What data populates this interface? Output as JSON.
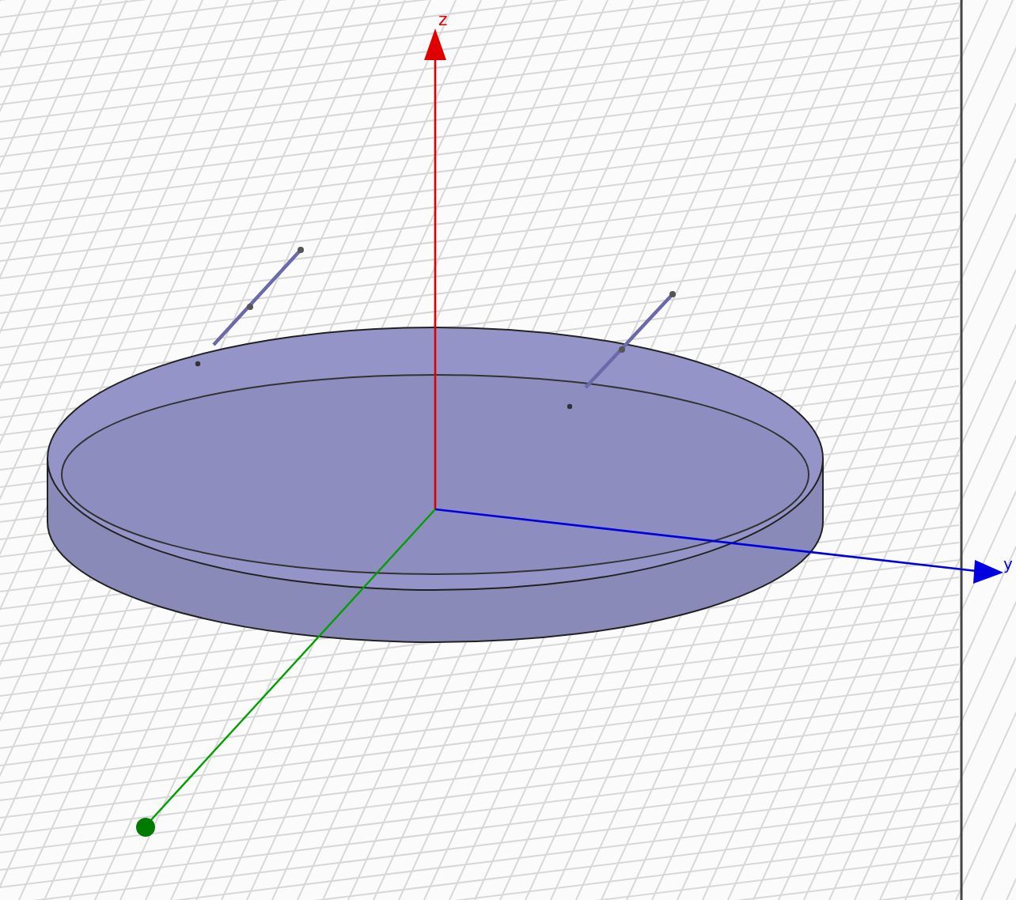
{
  "viewport": {
    "axes": [
      {
        "kind": "z",
        "label": "z"
      },
      {
        "kind": "y",
        "label": "y"
      },
      {
        "kind": "x"
      }
    ]
  }
}
